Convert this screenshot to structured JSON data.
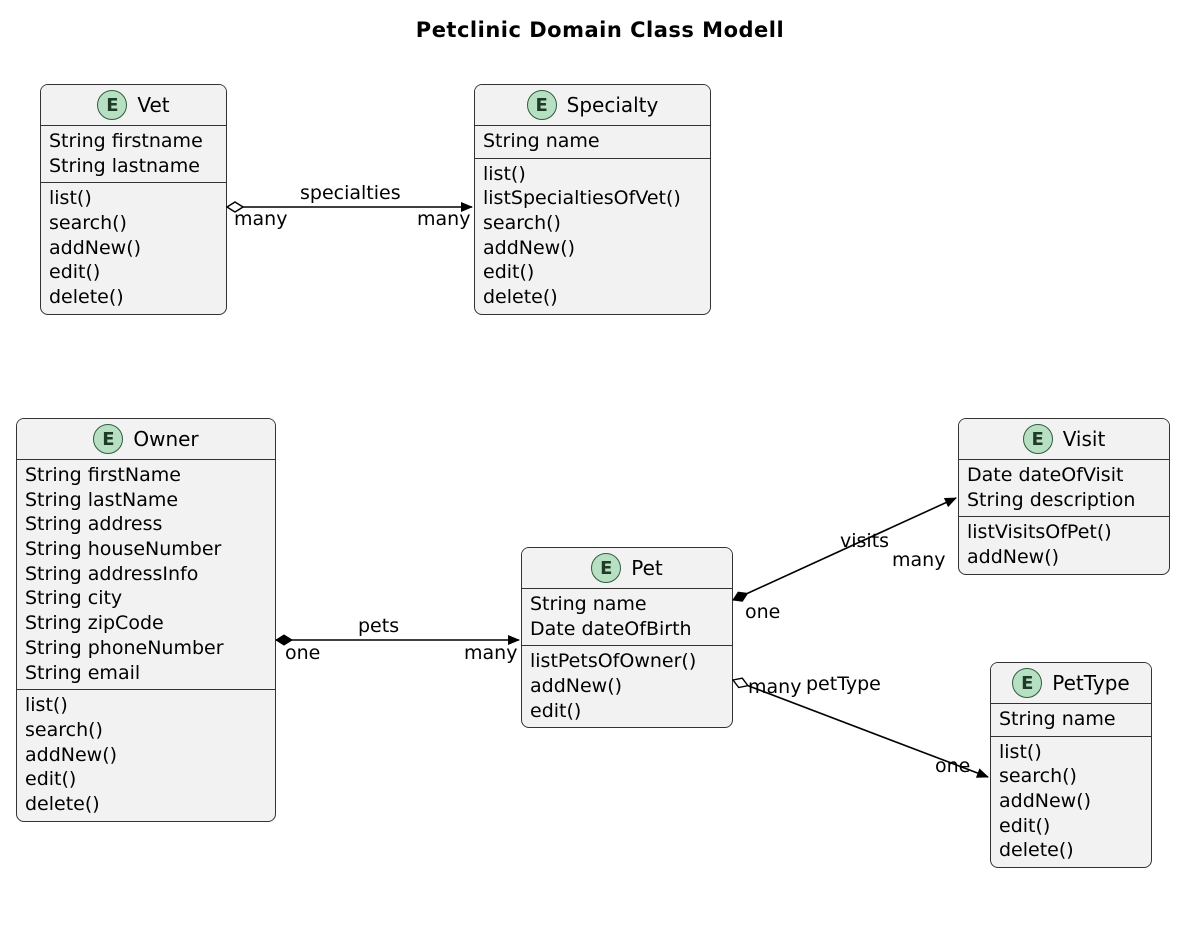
{
  "title": "Petclinic Domain Class Modell",
  "badge_letter": "E",
  "entities": {
    "vet": {
      "name": "Vet",
      "attributes": [
        "String firstname",
        "String lastname"
      ],
      "operations": [
        "list()",
        "search()",
        "addNew()",
        "edit()",
        "delete()"
      ]
    },
    "specialty": {
      "name": "Specialty",
      "attributes": [
        "String name"
      ],
      "operations": [
        "list()",
        "listSpecialtiesOfVet()",
        "search()",
        "addNew()",
        "edit()",
        "delete()"
      ]
    },
    "owner": {
      "name": "Owner",
      "attributes": [
        "String firstName",
        "String lastName",
        "String address",
        "String houseNumber",
        "String addressInfo",
        "String city",
        "String zipCode",
        "String phoneNumber",
        "String email"
      ],
      "operations": [
        "list()",
        "search()",
        "addNew()",
        "edit()",
        "delete()"
      ]
    },
    "pet": {
      "name": "Pet",
      "attributes": [
        "String name",
        "Date dateOfBirth"
      ],
      "operations": [
        "listPetsOfOwner()",
        "addNew()",
        "edit()"
      ]
    },
    "visit": {
      "name": "Visit",
      "attributes": [
        "Date dateOfVisit",
        "String description"
      ],
      "operations": [
        "listVisitsOfPet()",
        "addNew()"
      ]
    },
    "pettype": {
      "name": "PetType",
      "attributes": [
        "String name"
      ],
      "operations": [
        "list()",
        "search()",
        "addNew()",
        "edit()",
        "delete()"
      ]
    }
  },
  "relations": {
    "vet_specialty": {
      "label": "specialties",
      "source_mult": "many",
      "target_mult": "many"
    },
    "owner_pet": {
      "label": "pets",
      "source_mult": "one",
      "target_mult": "many"
    },
    "pet_visit": {
      "label": "visits",
      "source_mult": "one",
      "target_mult": "many"
    },
    "pet_pettype": {
      "label": "petType",
      "source_mult": "many",
      "target_mult": "one"
    }
  }
}
